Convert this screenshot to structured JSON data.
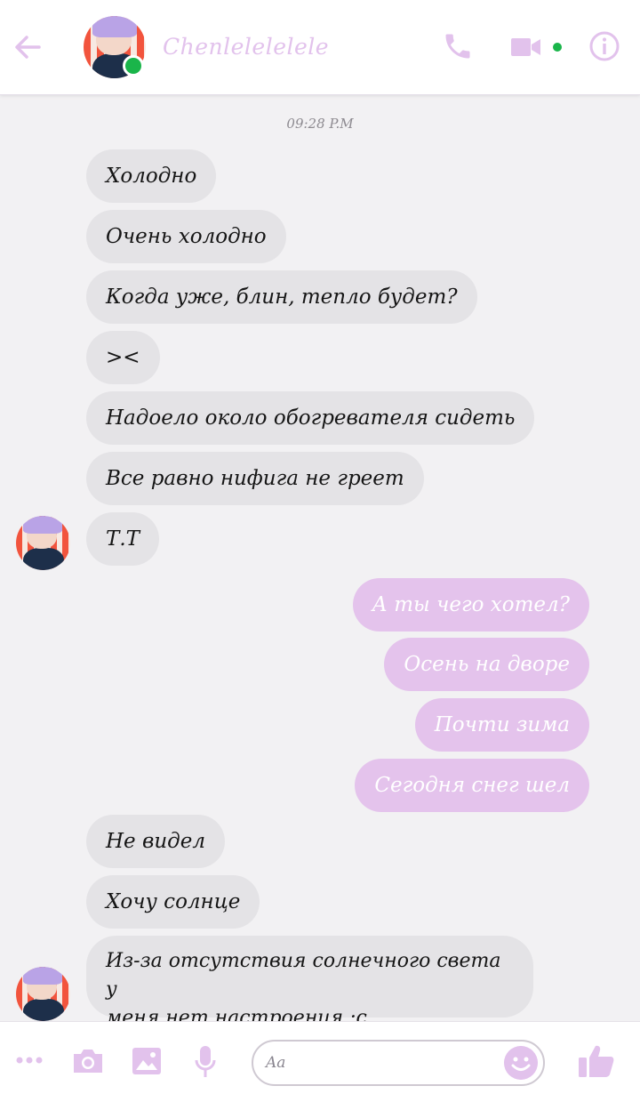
{
  "header": {
    "contact_name": "Chenlelelelele",
    "accent_color": "#e2c2ec",
    "online_color": "#1ab54a",
    "icons": [
      "back-arrow-icon",
      "phone-icon",
      "video-camera-icon",
      "info-icon"
    ]
  },
  "conversation": {
    "timestamp": "09:28 P.M",
    "incoming_group1": [
      "Холодно",
      "Очень холодно",
      "Когда уже, блин, тепло будет?",
      "><",
      "Надоело около обогревателя сидеть",
      "Все равно нифига не греет",
      "Т.Т"
    ],
    "outgoing": [
      "А ты чего хотел?",
      "Осень на дворе",
      "Почти зима",
      "Сегодня снег шел"
    ],
    "incoming_group2": [
      "Не видел",
      "Хочу солнце"
    ],
    "incoming_multiline": {
      "line1": "Из-за отсутствия солнечного света у",
      "line2": "меня нет настроения :с"
    }
  },
  "composer": {
    "placeholder": "Aa",
    "icons": [
      "more-icon",
      "camera-icon",
      "gallery-icon",
      "microphone-icon",
      "emoji-icon",
      "like-icon"
    ]
  }
}
